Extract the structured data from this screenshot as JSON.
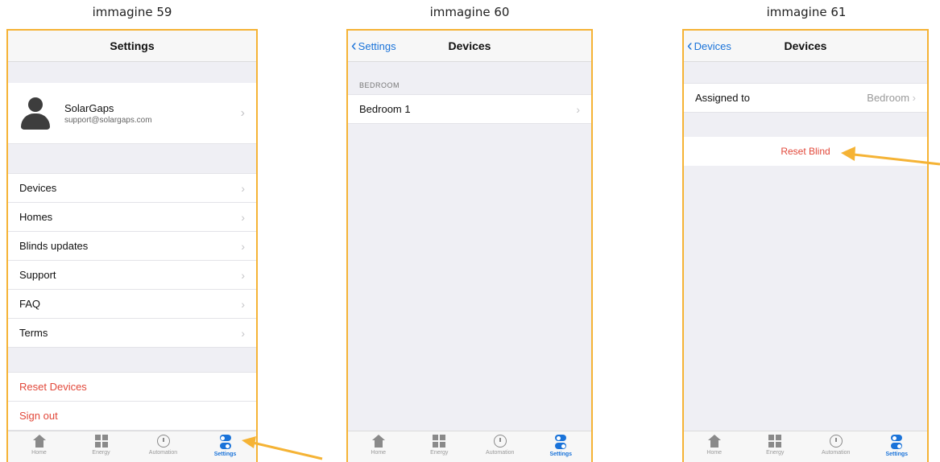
{
  "captions": [
    "immagine 59",
    "immagine 60",
    "immagine 61"
  ],
  "screen1": {
    "title": "Settings",
    "profile": {
      "name": "SolarGaps",
      "email": "support@solargaps.com"
    },
    "menu": [
      "Devices",
      "Homes",
      "Blinds updates",
      "Support",
      "FAQ",
      "Terms"
    ],
    "danger": [
      "Reset Devices",
      "Sign out"
    ]
  },
  "screen2": {
    "back": "Settings",
    "title": "Devices",
    "section": "BEDROOM",
    "item": "Bedroom 1"
  },
  "screen3": {
    "back": "Devices",
    "title": "Devices",
    "assigned_label": "Assigned to",
    "assigned_value": "Bedroom",
    "reset": "Reset Blind"
  },
  "tabs": [
    "Home",
    "Energy",
    "Automation",
    "Settings"
  ],
  "colors": {
    "accent": "#1a73d9",
    "danger": "#e2483a",
    "frame": "#f5b335",
    "arrow": "#f5b335"
  }
}
